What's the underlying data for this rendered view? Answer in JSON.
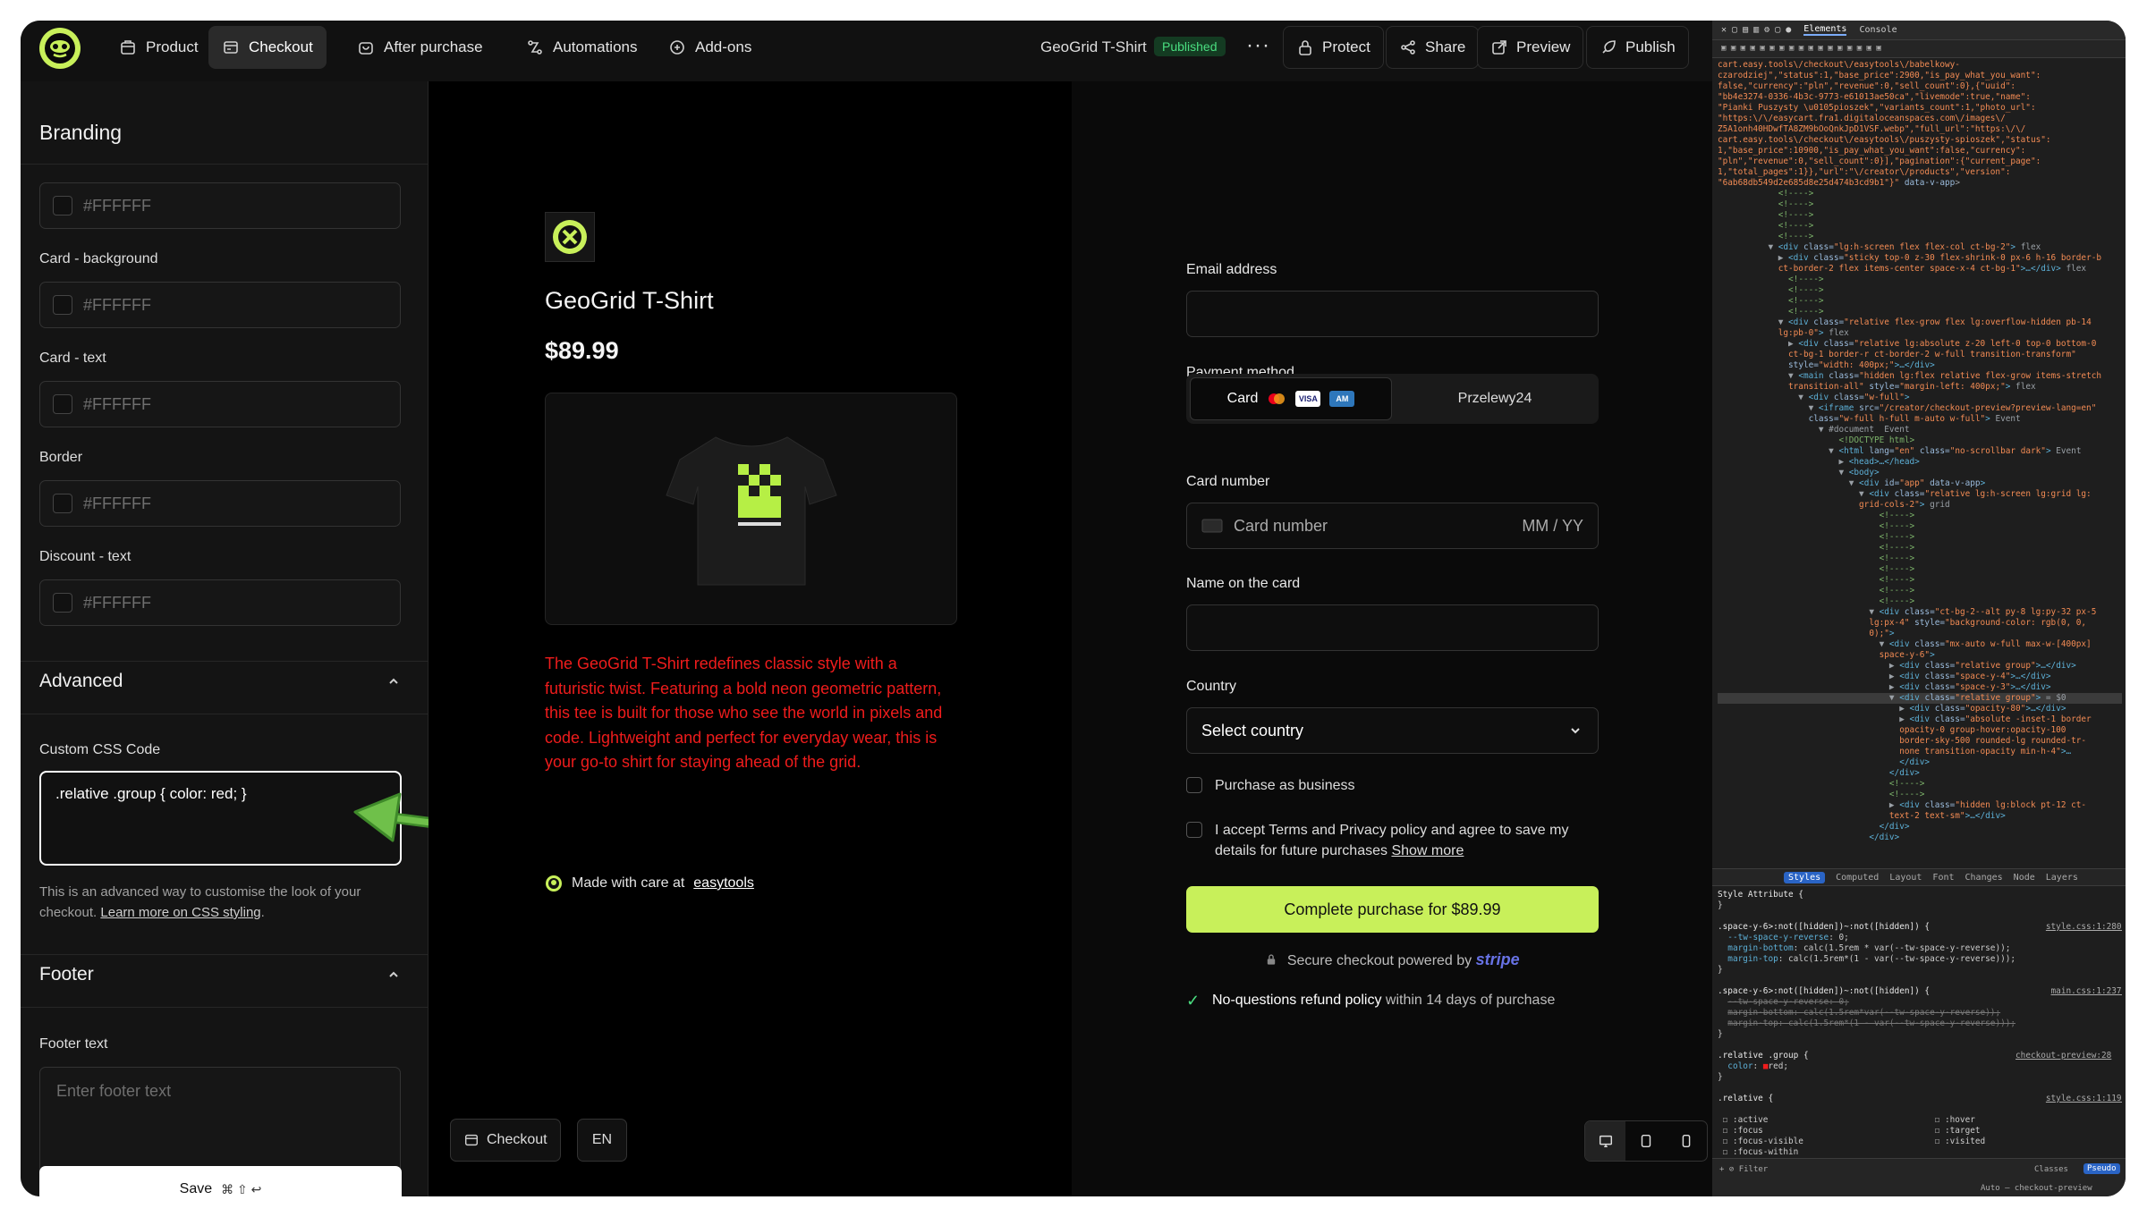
{
  "topbar": {
    "nav": [
      {
        "label": "Product",
        "icon": "box-icon"
      },
      {
        "label": "Checkout",
        "icon": "cart-icon",
        "active": true
      },
      {
        "label": "After purchase",
        "icon": "bag-icon"
      },
      {
        "label": "Automations",
        "icon": "workflow-icon"
      },
      {
        "label": "Add-ons",
        "icon": "addon-icon"
      }
    ],
    "product_name": "GeoGrid T-Shirt",
    "status": "Published",
    "more": "···",
    "actions": [
      {
        "label": "Protect",
        "icon": "lock-icon"
      },
      {
        "label": "Share",
        "icon": "share-icon"
      },
      {
        "label": "Preview",
        "icon": "external-link-icon"
      },
      {
        "label": "Publish",
        "icon": "rocket-icon"
      }
    ]
  },
  "sidebar": {
    "branding_title": "Branding",
    "fields": [
      {
        "label": "",
        "value": "#FFFFFF"
      },
      {
        "label": "Card - background",
        "value": "#FFFFFF"
      },
      {
        "label": "Card - text",
        "value": "#FFFFFF"
      },
      {
        "label": "Border",
        "value": "#FFFFFF"
      },
      {
        "label": "Discount - text",
        "value": "#FFFFFF"
      }
    ],
    "advanced_title": "Advanced",
    "css_label": "Custom CSS Code",
    "css_value": ".relative .group { color: red; }",
    "css_help": "This is an advanced way to customise the look of your checkout.",
    "css_help_link": "Learn more on CSS styling",
    "footer_title": "Footer",
    "footer_text_label": "Footer text",
    "footer_text_placeholder": "Enter footer text",
    "save_label": "Save",
    "save_shortcut": "⌘ ⇧ ↩"
  },
  "preview": {
    "product_title": "GeoGrid T-Shirt",
    "price": "$89.99",
    "description": "The GeoGrid T-Shirt redefines classic style with a futuristic twist. Featuring a bold neon geometric pattern, this tee is built for those who see the world in pixels and code. Lightweight and perfect for everyday wear, this is your go-to shirt for staying ahead of the grid.",
    "made_with": "Made with care at",
    "made_with_link": "easytools",
    "checkout_btn": "Checkout",
    "lang_btn": "EN"
  },
  "checkout": {
    "email_label": "Email address",
    "payment_label": "Payment method",
    "pm_card": "Card",
    "pm_p24": "Przelewy24",
    "card_number_label": "Card number",
    "card_number_placeholder": "Card number",
    "mmyy": "MM / YY",
    "name_label": "Name on the card",
    "country_label": "Country",
    "country_value": "Select country",
    "business": "Purchase as business",
    "terms": "I accept Terms and Privacy policy and agree to save my details for future purchases",
    "terms_link": "Show more",
    "complete_btn": "Complete purchase for $89.99",
    "secure": "Secure checkout powered by",
    "stripe": "stripe",
    "refund_bold": "No-questions refund policy",
    "refund_rest": "within 14 days of purchase"
  },
  "devtools": {
    "tabs": [
      "Elements",
      "Console"
    ],
    "styles_tabs": [
      "Styles",
      "Computed",
      "Layout",
      "Font",
      "Changes",
      "Node",
      "Layers"
    ],
    "filter_placeholder": "Filter",
    "classes": "Classes",
    "pseudo": "Pseudo",
    "context": "Auto — checkout-preview"
  },
  "colors": {
    "accent": "#c8f05a",
    "danger": "#ef1c1c",
    "published": "#4ade80",
    "stripe": "#6772e5"
  }
}
